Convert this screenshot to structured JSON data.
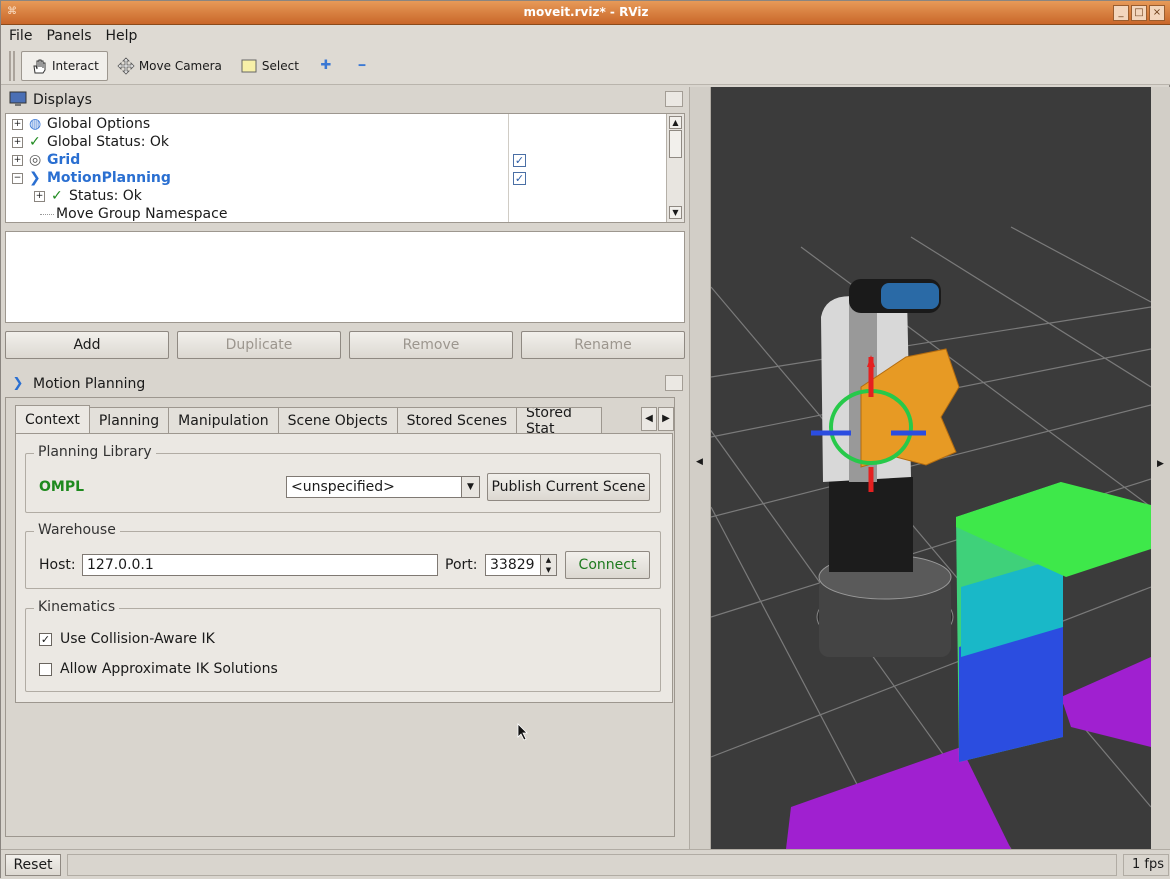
{
  "window": {
    "title": "moveit.rviz* - RViz",
    "sys_glyph": "⌘",
    "minimize": "_",
    "maximize": "□",
    "close": "×"
  },
  "menu": [
    "File",
    "Panels",
    "Help"
  ],
  "toolbar": {
    "interact": "Interact",
    "move_camera": "Move Camera",
    "select": "Select",
    "plus_glyph": "✚",
    "minus_glyph": "━"
  },
  "displays": {
    "title": "Displays",
    "rows": [
      {
        "label": "Global Options",
        "icon": "globe-icon",
        "glyph": "◍"
      },
      {
        "label": "Global Status: Ok",
        "icon": "check-icon",
        "glyph": "✓"
      },
      {
        "label": "Grid",
        "icon": "eye-icon",
        "glyph": "◎",
        "checked": true
      },
      {
        "label": "MotionPlanning",
        "icon": "motion-planning-icon",
        "glyph": "❯",
        "checked": true
      },
      {
        "label": "Status: Ok",
        "icon": "check-icon",
        "glyph": "✓"
      },
      {
        "label": "Move Group Namespace"
      }
    ],
    "check_glyph": "✓",
    "buttons": {
      "add": "Add",
      "duplicate": "Duplicate",
      "remove": "Remove",
      "rename": "Rename"
    }
  },
  "motion_planning": {
    "title": "Motion Planning",
    "tabs": [
      "Context",
      "Planning",
      "Manipulation",
      "Scene Objects",
      "Stored Scenes",
      "Stored Stat"
    ],
    "planning_library": {
      "label": "Planning Library",
      "library": "OMPL",
      "planner": "<unspecified>",
      "publish_button": "Publish Current Scene"
    },
    "warehouse": {
      "label": "Warehouse",
      "host_label": "Host:",
      "host": "127.0.0.1",
      "port_label": "Port:",
      "port": "33829",
      "connect_button": "Connect"
    },
    "kinematics": {
      "label": "Kinematics",
      "collision_aware": {
        "label": "Use Collision-Aware IK",
        "checked": true
      },
      "approximate": {
        "label": "Allow Approximate IK Solutions",
        "checked": false
      }
    }
  },
  "status": {
    "reset": "Reset",
    "fps": "1 fps"
  },
  "colors": {
    "title_bar": "#d87a3c",
    "link_blue": "#2a6fd1",
    "ompl_green": "#1e8a1e"
  }
}
